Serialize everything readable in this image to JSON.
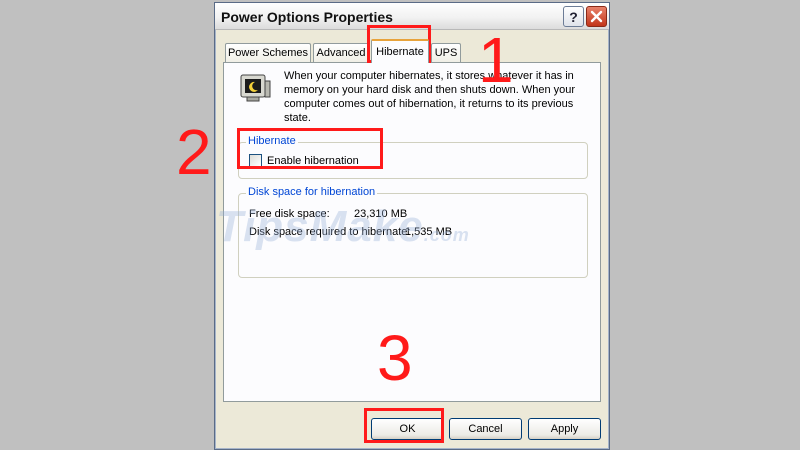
{
  "window": {
    "title": "Power Options Properties",
    "help_label": "?"
  },
  "tabs": [
    {
      "label": "Power Schemes"
    },
    {
      "label": "Advanced"
    },
    {
      "label": "Hibernate",
      "active": true
    },
    {
      "label": "UPS"
    }
  ],
  "hibernate_panel": {
    "description": "When your computer hibernates, it stores whatever it has in memory on your hard disk and then shuts down. When your computer comes out of hibernation, it returns to its previous state.",
    "hibernate_group": {
      "title": "Hibernate",
      "checkbox_label": "Enable hibernation",
      "checked": false
    },
    "disk_group": {
      "title": "Disk space for hibernation",
      "free_label": "Free disk space:",
      "free_value": "23,310 MB",
      "required_label": "Disk space required to hibernate:",
      "required_value": "1,535 MB"
    }
  },
  "buttons": {
    "ok": "OK",
    "cancel": "Cancel",
    "apply": "Apply"
  },
  "watermark": {
    "text": "TipsMake",
    "suffix": ".com"
  },
  "annotations": {
    "step1": "1",
    "step2": "2",
    "step3": "3",
    "color": "#ff1a1a"
  }
}
